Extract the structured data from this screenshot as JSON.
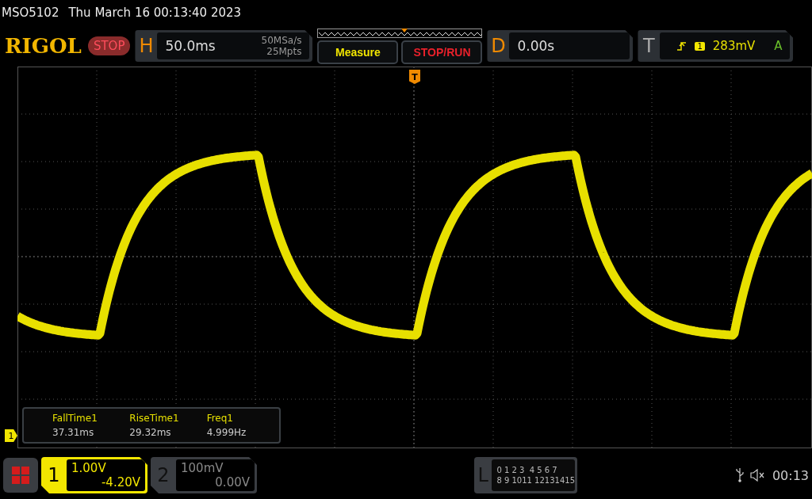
{
  "status_bar": {
    "model": "MSO5102",
    "datetime": "Thu March 16 00:13:40 2023"
  },
  "toolbar": {
    "logo": "RIGOL",
    "run_state": "STOP",
    "horizontal": {
      "label": "H",
      "timebase": "50.0ms",
      "sample_rate": "50MSa/s",
      "memory_depth": "25Mpts"
    },
    "buttons": [
      {
        "label": "Measure",
        "kind": "menu"
      },
      {
        "label": "STOP/RUN",
        "kind": "run"
      }
    ],
    "delay": {
      "label": "D",
      "value": "0.00s"
    },
    "trigger": {
      "label": "T",
      "source": "1",
      "level": "283mV",
      "mode": "A"
    }
  },
  "grid": {
    "trigger_marker": "T",
    "channel_marker": "1"
  },
  "measurements": [
    {
      "name": "FallTime1",
      "value": "37.31ms"
    },
    {
      "name": "RiseTime1",
      "value": "29.32ms"
    },
    {
      "name": "Freq1",
      "value": "4.999Hz"
    }
  ],
  "channels": [
    {
      "number": "1",
      "scale": "1.00V",
      "offset": "-4.20V",
      "selected": true
    },
    {
      "number": "2",
      "scale": "100mV",
      "offset": "0.00V",
      "selected": false
    }
  ],
  "logic": {
    "label": "L",
    "rows": [
      "0 1 2 3  4 5 6 7",
      "8 9 1011 12131415"
    ]
  },
  "system": {
    "time": "00:13"
  }
}
